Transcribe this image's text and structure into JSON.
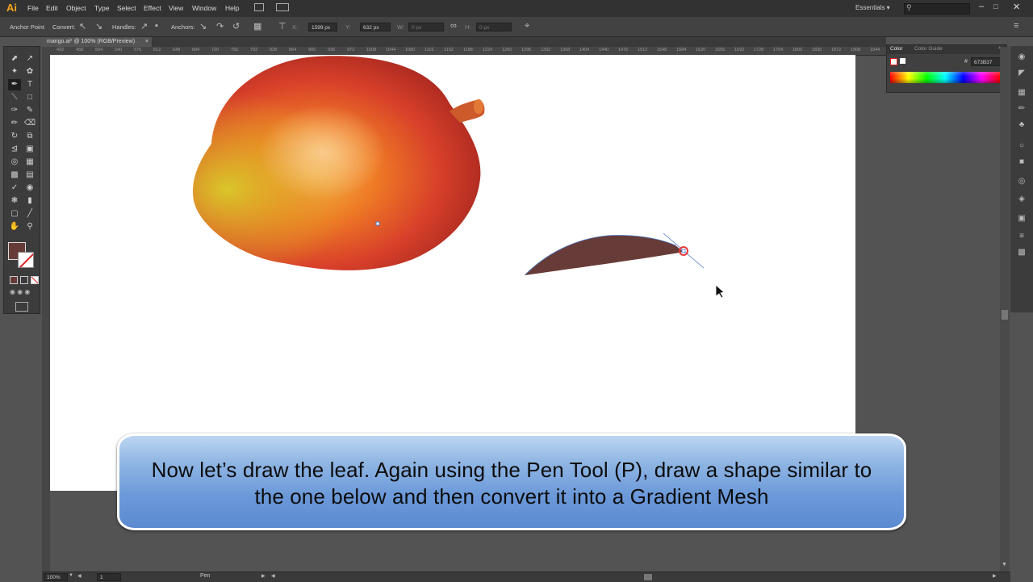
{
  "app": {
    "logo": "Ai",
    "workspace": "Essentials ▾"
  },
  "menu": [
    "File",
    "Edit",
    "Object",
    "Type",
    "Select",
    "Effect",
    "View",
    "Window",
    "Help"
  ],
  "control_bar": {
    "anchor_point": "Anchor Point",
    "convert": "Convert:",
    "handles": "Handles:",
    "anchors": "Anchors:",
    "x_label": "X:",
    "x_value": "1599 px",
    "y_label": "Y:",
    "y_value": "632 px",
    "w_label": "W:",
    "w_value": "0 px",
    "h_label": "H:",
    "h_value": "0 px"
  },
  "document": {
    "tab_title": "mango.ai* @ 100% (RGB/Preview)",
    "close": "×"
  },
  "ruler_ticks": [
    "432",
    "468",
    "504",
    "540",
    "576",
    "612",
    "648",
    "684",
    "720",
    "756",
    "792",
    "828",
    "864",
    "900",
    "936",
    "972",
    "1008",
    "1044",
    "1080",
    "1116",
    "1152",
    "1188",
    "1224",
    "1260",
    "1296",
    "1332",
    "1368",
    "1404",
    "1440",
    "1476",
    "1512",
    "1548",
    "1584",
    "1620",
    "1656",
    "1692",
    "1728",
    "1764",
    "1800",
    "1836",
    "1872",
    "1908",
    "1944"
  ],
  "color_panel": {
    "tab_color": "Color",
    "tab_guide": "Color Guide",
    "hex_label": "#",
    "hex_value": "673B37"
  },
  "status": {
    "zoom": "100%",
    "page": "1",
    "tool": "Pen"
  },
  "caption": "Now let’s draw the leaf. Again using the Pen Tool (P), draw a shape similar to the one below and then convert it into a Gradient Mesh",
  "colors": {
    "fill": "#673b37",
    "accent": "#f7a31c"
  },
  "icons": [
    "selection-icon",
    "direct-selection-icon",
    "pen-icon",
    "type-icon",
    "hand-icon",
    "zoom-icon",
    "search-icon",
    "cursor-icon"
  ]
}
